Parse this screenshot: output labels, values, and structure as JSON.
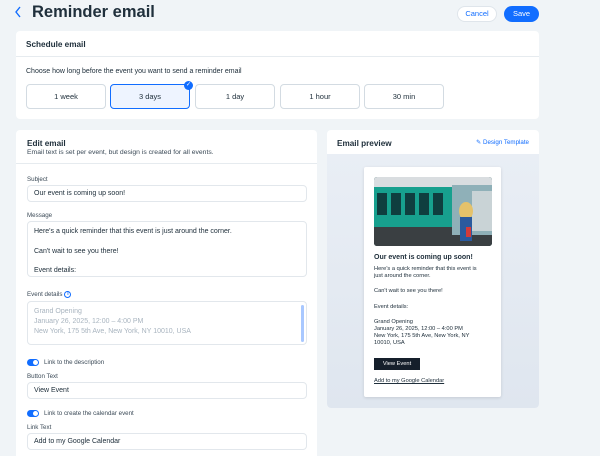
{
  "header": {
    "back_icon": "chevron-left-icon",
    "title": "Reminder email",
    "cancel_label": "Cancel",
    "save_label": "Save"
  },
  "colors": {
    "accent": "#116dff",
    "background": "#f0f4f7",
    "dark_button": "#151f2b"
  },
  "schedule": {
    "title": "Schedule email",
    "description": "Choose how long before the event you want to send a reminder email",
    "options": [
      "1 week",
      "3 days",
      "1 day",
      "1 hour",
      "30 min"
    ],
    "selected": "3 days"
  },
  "edit": {
    "title": "Edit email",
    "subtitle": "Email text is set per event, but design is created for all events.",
    "subject_label": "Subject",
    "subject_value": "Our event is coming up soon!",
    "message_label": "Message",
    "message_lines": [
      "Here's a quick reminder that this event is just around the corner.",
      "",
      "Can't wait to see you there!",
      "",
      "Event details:"
    ],
    "event_details_label": "Event details",
    "event_details_info_icon": "info-icon",
    "event_details_lines": [
      "Grand Opening",
      "January 26, 2025, 12:00 – 4:00 PM",
      "New York, 175 5th Ave, New York, NY 10010, USA"
    ],
    "toggle_description_label": "Link to the description",
    "toggle_description_on": true,
    "button_text_label": "Button Text",
    "button_text_value": "View Event",
    "toggle_calendar_label": "Link to create the calendar event",
    "toggle_calendar_on": true,
    "link_text_label": "Link Text",
    "link_text_value": "Add to my Google Calendar"
  },
  "preview": {
    "title": "Email preview",
    "design_link": "Design Template",
    "design_icon": "pencil-icon",
    "email": {
      "heading": "Our event is coming up soon!",
      "line1": "Here's a quick reminder that this event is",
      "line2": "just around the corner.",
      "line3": "Can't wait to see you there!",
      "line4": "Event details:",
      "detail1": "Grand Opening",
      "detail2": "January 26, 2025, 12:00 – 4:00 PM",
      "detail3": "New York, 175 5th Ave, New York, NY",
      "detail4": "10010, USA",
      "button": "View Event",
      "link": "Add to my Google Calendar"
    }
  }
}
